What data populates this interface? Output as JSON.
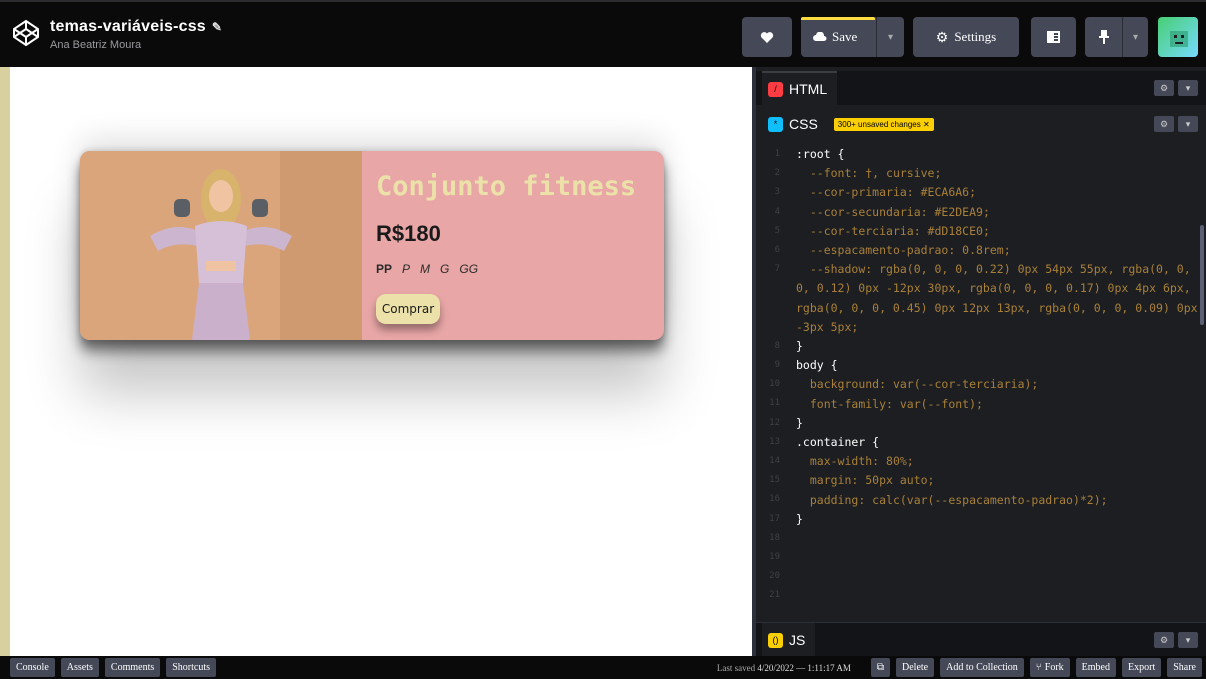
{
  "header": {
    "title": "temas-variáveis-css",
    "author": "Ana Beatriz Moura",
    "save_label": "Save",
    "settings_label": "Settings"
  },
  "preview": {
    "product_title": "Conjunto fitness",
    "price": "R$180",
    "sizes": [
      "PP",
      "P",
      "M",
      "G",
      "GG"
    ],
    "buy_label": "Comprar"
  },
  "editor": {
    "html_tab": "HTML",
    "css_tab": "CSS",
    "css_badge": "300+ unsaved changes ✕",
    "js_tab": "JS",
    "line_numbers": [
      "1",
      "2",
      "3",
      "4",
      "5",
      "6",
      "7",
      "",
      "",
      "",
      "8",
      "9",
      "10",
      "11",
      "12",
      "13",
      "14",
      "15",
      "16",
      "17",
      "18",
      "19",
      "20",
      "21"
    ],
    "code_lines": [
      ":root {",
      "  --font: †, cursive;",
      "  --cor-primaria: #ECA6A6;",
      "  --cor-secundaria: #E2DEA9;",
      "  --cor-terciaria: #dD18CE0;",
      "  --espacamento-padrao: 0.8rem;",
      "  --shadow: rgba(0, 0, 0, 0.22) 0px 54px 55px, rgba(0, 0, 0, 0.12) 0px -12px 30px, rgba(0, 0, 0, 0.17) 0px 4px 6px, rgba(0, 0, 0, 0.45) 0px 12px 13px, rgba(0, 0, 0, 0.09) 0px -3px 5px;",
      "}",
      "",
      "body {",
      "  background: var(--cor-terciaria);",
      "  font-family: var(--font);",
      "}",
      "",
      ".container {",
      "  max-width: 80%;",
      "  margin: 50px auto;",
      "  padding: calc(var(--espacamento-padrao)*2);",
      "",
      "}"
    ]
  },
  "footer": {
    "left_buttons": [
      "Console",
      "Assets",
      "Comments",
      "Shortcuts"
    ],
    "last_saved_label": "Last saved",
    "last_saved_value": "4/20/2022 — 1:11:17 AM",
    "right_buttons": [
      "Delete",
      "Add to Collection",
      "Fork",
      "Embed",
      "Export",
      "Share"
    ]
  },
  "colors": {
    "card_bg": "#ECA6A6",
    "accent_yellow": "#E2DEA9",
    "save_highlight": "#ffdd40",
    "html_icon": "#ff3c41",
    "css_icon": "#0ebeff",
    "js_icon": "#fcd000"
  },
  "icons": [
    "codepen-logo-icon",
    "pencil-icon",
    "heart-icon",
    "cloud-icon",
    "gear-icon",
    "layout-icon",
    "pin-icon",
    "chevron-down-icon",
    "fork-icon",
    "external-icon"
  ]
}
